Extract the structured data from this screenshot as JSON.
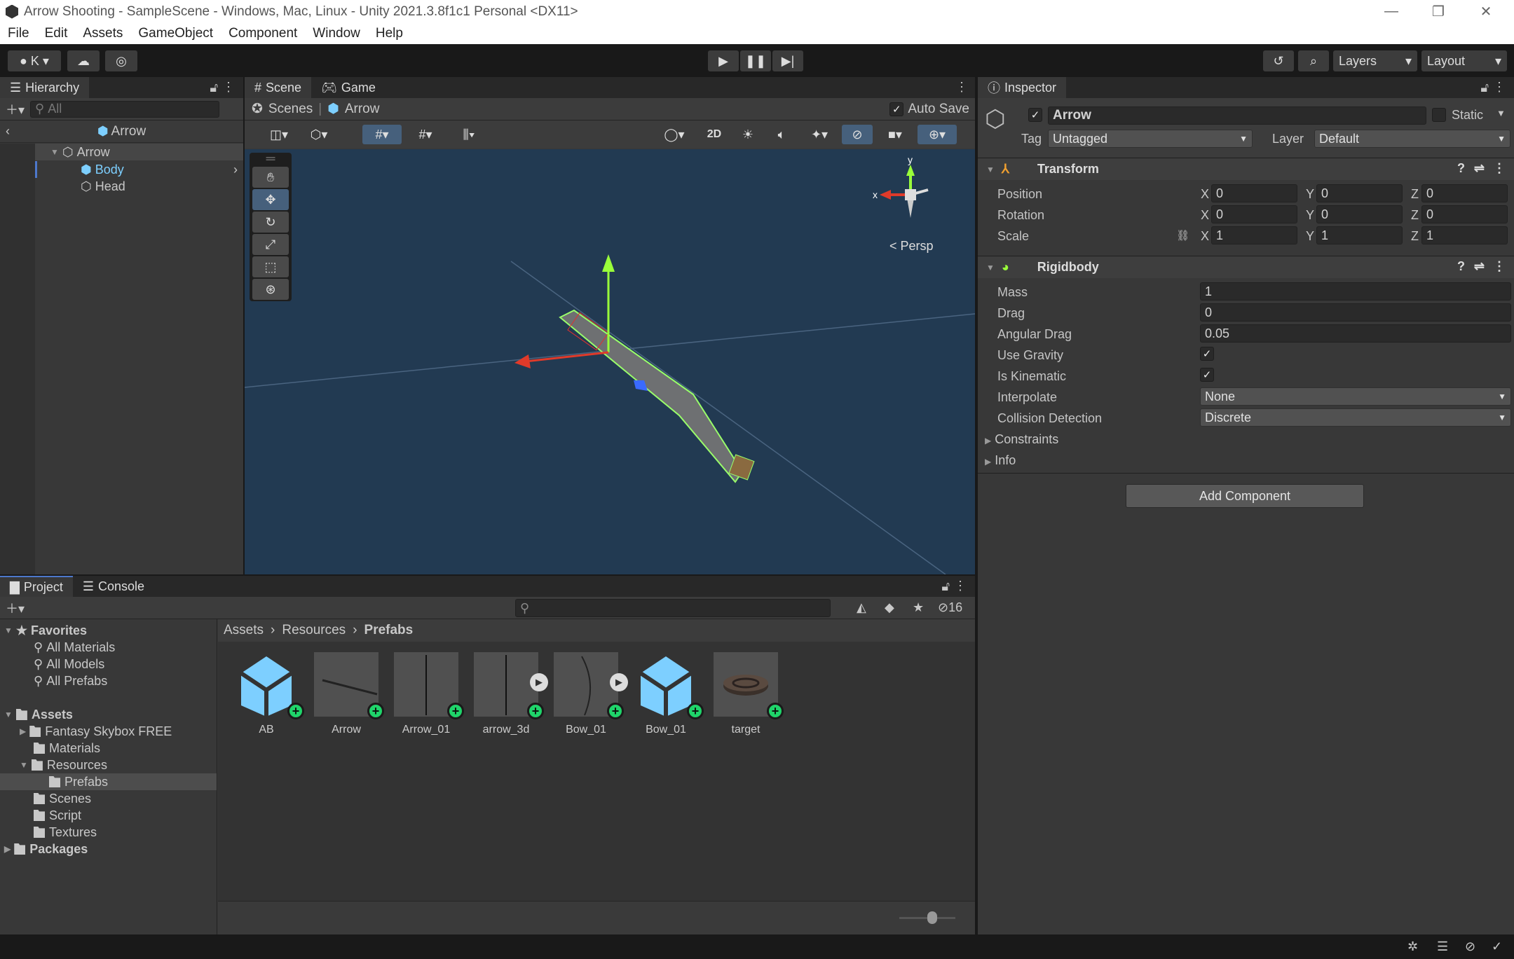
{
  "window": {
    "title": "Arrow Shooting - SampleScene - Windows, Mac, Linux - Unity 2021.3.8f1c1 Personal <DX11>"
  },
  "menu": [
    "File",
    "Edit",
    "Assets",
    "GameObject",
    "Component",
    "Window",
    "Help"
  ],
  "toolbar": {
    "account": "K",
    "layers": "Layers",
    "layout": "Layout"
  },
  "hierarchy": {
    "tab": "Hierarchy",
    "search_placeholder": "All",
    "root": "Arrow",
    "items": [
      {
        "label": "Arrow",
        "level": 0,
        "expanded": true
      },
      {
        "label": "Body",
        "level": 1,
        "prefab": true
      },
      {
        "label": "Head",
        "level": 1
      }
    ]
  },
  "scene": {
    "tabs": [
      "Scene",
      "Game"
    ],
    "breadcrumb": [
      "Scenes",
      "Arrow"
    ],
    "auto_save": "Auto Save",
    "auto_save_checked": true,
    "mode_2d": "2D",
    "persp": "Persp",
    "gizmo_axes": {
      "y": "y",
      "x": "x"
    }
  },
  "inspector": {
    "tab": "Inspector",
    "object_name": "Arrow",
    "active": true,
    "static_label": "Static",
    "tag_label": "Tag",
    "tag": "Untagged",
    "layer_label": "Layer",
    "layer": "Default",
    "transform": {
      "title": "Transform",
      "rows": [
        {
          "label": "Position",
          "x": "0",
          "y": "0",
          "z": "0"
        },
        {
          "label": "Rotation",
          "x": "0",
          "y": "0",
          "z": "0"
        },
        {
          "label": "Scale",
          "x": "1",
          "y": "1",
          "z": "1"
        }
      ]
    },
    "rigidbody": {
      "title": "Rigidbody",
      "mass_label": "Mass",
      "mass": "1",
      "drag_label": "Drag",
      "drag": "0",
      "angular_drag_label": "Angular Drag",
      "angular_drag": "0.05",
      "use_gravity_label": "Use Gravity",
      "use_gravity": true,
      "is_kinematic_label": "Is Kinematic",
      "is_kinematic": true,
      "interpolate_label": "Interpolate",
      "interpolate": "None",
      "collision_label": "Collision Detection",
      "collision": "Discrete",
      "constraints": "Constraints",
      "info": "Info"
    },
    "add_component": "Add Component"
  },
  "project": {
    "tabs": [
      "Project",
      "Console"
    ],
    "hidden_count": "16",
    "favorites": {
      "label": "Favorites",
      "items": [
        "All Materials",
        "All Models",
        "All Prefabs"
      ]
    },
    "assets": {
      "label": "Assets",
      "items": [
        "Fantasy Skybox FREE",
        "Materials",
        "Resources",
        "Prefabs",
        "Scenes",
        "Script",
        "Textures"
      ]
    },
    "packages": "Packages",
    "breadcrumb": [
      "Assets",
      "Resources",
      "Prefabs"
    ],
    "files": [
      {
        "name": "AB",
        "type": "cube"
      },
      {
        "name": "Arrow",
        "type": "model"
      },
      {
        "name": "Arrow_01",
        "type": "model"
      },
      {
        "name": "arrow_3d",
        "type": "model-variant"
      },
      {
        "name": "Bow_01",
        "type": "model-variant"
      },
      {
        "name": "Bow_01",
        "type": "cube"
      },
      {
        "name": "target",
        "type": "model"
      }
    ]
  },
  "colors": {
    "accent": "#4d78cc",
    "prefab": "#7dcfff",
    "add_badge": "#1fd46a",
    "scene_bg": "#223a52"
  }
}
